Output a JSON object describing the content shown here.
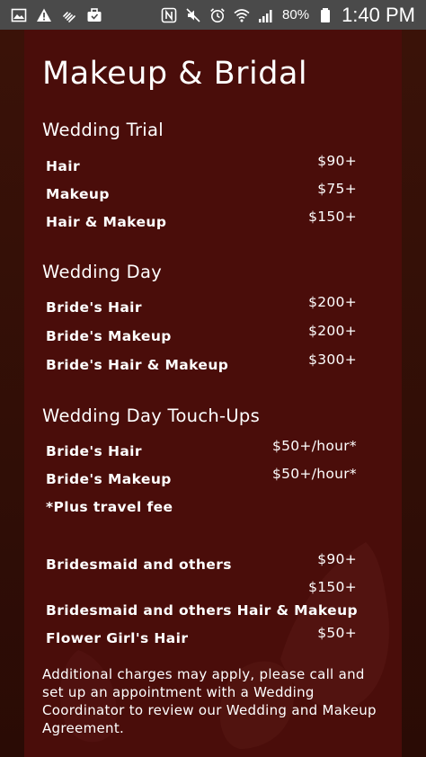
{
  "status_bar": {
    "icons_left": [
      "gallery-icon",
      "warning-icon",
      "hand-icon",
      "briefcase-icon"
    ],
    "icons_right": [
      "nfc-icon",
      "mute-icon",
      "alarm-icon",
      "wifi-icon",
      "signal-icon"
    ],
    "battery": "80%",
    "time": "1:40 PM"
  },
  "page": {
    "title": "Makeup & Bridal"
  },
  "sections": {
    "trial": {
      "title": "Wedding Trial",
      "items": [
        {
          "name": "Hair",
          "price": "$90+"
        },
        {
          "name": "Makeup",
          "price": "$75+"
        },
        {
          "name": "Hair & Makeup",
          "price": "$150+"
        }
      ]
    },
    "day": {
      "title": "Wedding Day",
      "items": [
        {
          "name": "Bride's Hair",
          "price": "$200+"
        },
        {
          "name": "Bride's Makeup",
          "price": "$200+"
        },
        {
          "name": "Bride's Hair & Makeup",
          "price": "$300+"
        }
      ]
    },
    "touchups": {
      "title": "Wedding Day Touch-Ups",
      "items": [
        {
          "name": "Bride's Hair",
          "price": "$50+/hour*"
        },
        {
          "name": "Bride's Makeup",
          "price": "$50+/hour*"
        }
      ],
      "note": "*Plus travel fee"
    },
    "others": {
      "items": [
        {
          "name": "Bridesmaid and others",
          "price": "$90+"
        },
        {
          "name": "Bridesmaid and others Hair & Makeup",
          "price": "$150+"
        },
        {
          "name": "Flower Girl's Hair",
          "price": "$50+"
        }
      ]
    }
  },
  "footer": {
    "text": "Additional charges may apply, please call and set up an appointment with a Wedding Coordinator to review our Wedding and Makeup Agreement."
  },
  "colors": {
    "status_bar": "#4a4a4a",
    "background": "#2a0c06",
    "panel": "#4a0d0a",
    "text": "#ffffff"
  }
}
